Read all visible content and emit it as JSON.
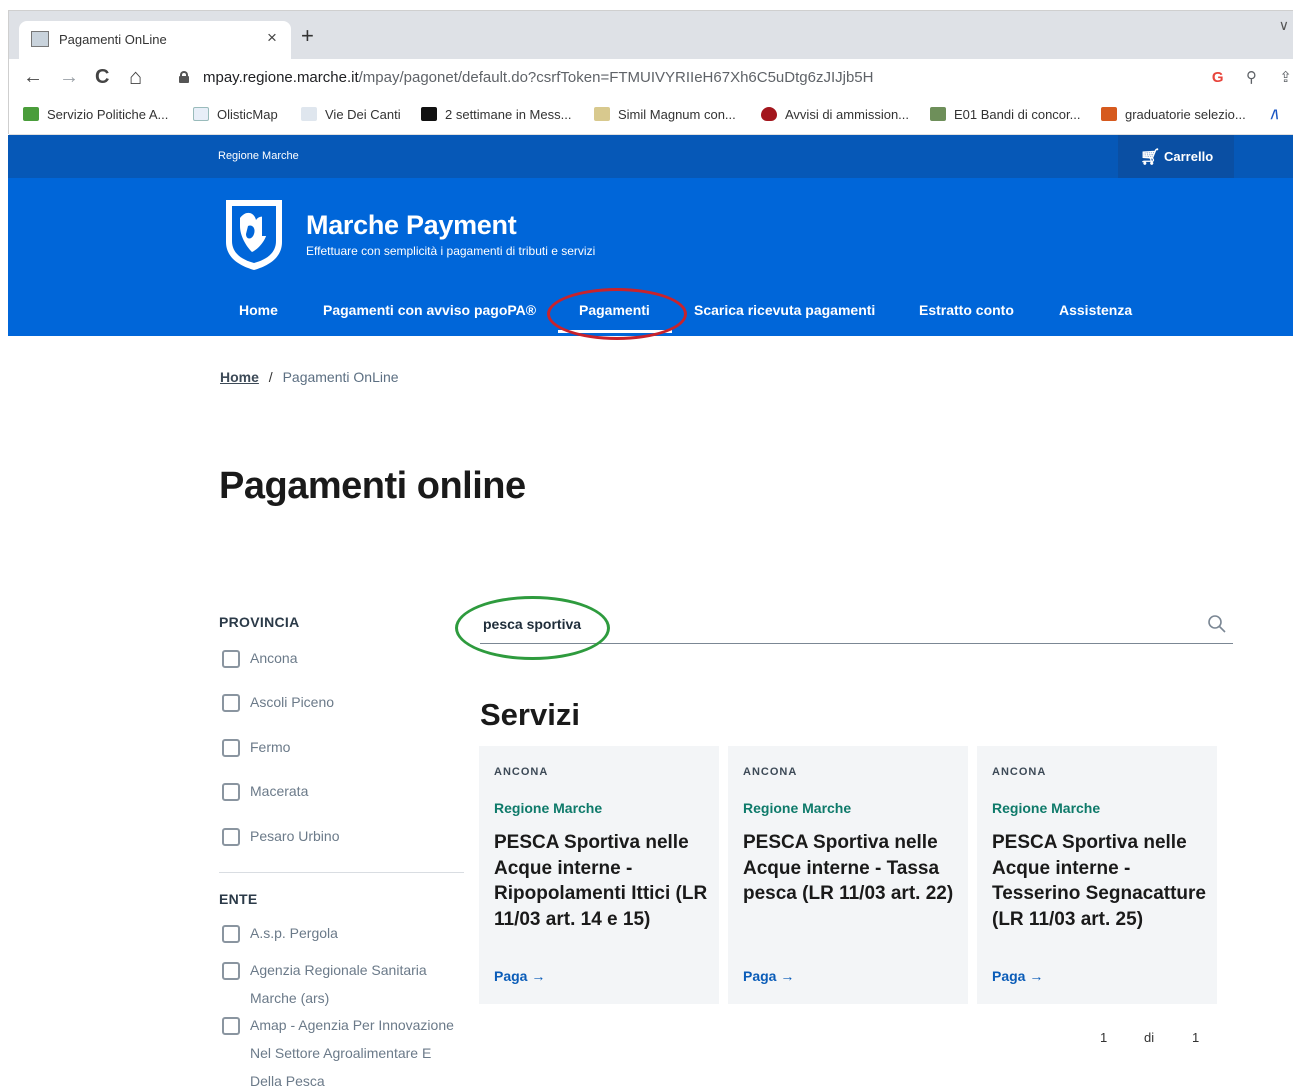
{
  "browser": {
    "tab_title": "Pagamenti OnLine",
    "tab_close": "×",
    "new_tab": "+",
    "tabstrip_menu": "∨",
    "url_host": "mpay.regione.marche.it",
    "url_path": "/mpay/pagonet/default.do?csrfToken=FTMUIVYRIIeH67Xh6C5uDtg6zJIJjb5H",
    "nav": {
      "back": "←",
      "forward": "→",
      "reload": "C",
      "home": "⌂"
    },
    "omnibox_icons": {
      "google": "G",
      "zoom": "⚲",
      "share": "⇪"
    },
    "bookmarks": [
      {
        "label": "Servizio Politiche A...",
        "color": "#4a9d3b"
      },
      {
        "label": "OlisticMap",
        "color": "#e7eef8"
      },
      {
        "label": "Vie Dei Canti",
        "color": "#dfe6ee"
      },
      {
        "label": "2 settimane in Mess...",
        "color": "#111111"
      },
      {
        "label": "Simil Magnum con...",
        "color": "#d8c98e"
      },
      {
        "label": "Avvisi di ammission...",
        "color": "#a3161d"
      },
      {
        "label": "E01 Bandi di concor...",
        "color": "#6e8f5a"
      },
      {
        "label": "graduatorie selezio...",
        "color": "#d65a1e"
      }
    ]
  },
  "site": {
    "region_label": "Regione Marche",
    "cart_label": "Carrello",
    "brand_title": "Marche Payment",
    "brand_subtitle": "Effettuare con semplicità i pagamenti di tributi e servizi",
    "nav": [
      {
        "label": "Home",
        "active": false
      },
      {
        "label": "Pagamenti con avviso pagoPA®",
        "active": false
      },
      {
        "label": "Pagamenti",
        "active": true
      },
      {
        "label": "Scarica ricevuta pagamenti",
        "active": false
      },
      {
        "label": "Estratto conto",
        "active": false
      },
      {
        "label": "Assistenza",
        "active": false
      }
    ]
  },
  "breadcrumb": {
    "home": "Home",
    "separator": "/",
    "current": "Pagamenti OnLine"
  },
  "page_title": "Pagamenti online",
  "filters": {
    "provincia": {
      "heading": "PROVINCIA",
      "options": [
        "Ancona",
        "Ascoli Piceno",
        "Fermo",
        "Macerata",
        "Pesaro Urbino"
      ]
    },
    "ente": {
      "heading": "ENTE",
      "options": [
        "A.s.p. Pergola",
        "Agenzia Regionale Sanitaria Marche (ars)",
        "Amap - Agenzia Per Innovazione Nel Settore Agroalimentare E Della Pesca"
      ]
    }
  },
  "search": {
    "value": "pesca sportiva"
  },
  "section_title": "Servizi",
  "cards": [
    {
      "category": "ANCONA",
      "ente": "Regione Marche",
      "title": "PESCA Sportiva nelle Acque interne - Ripopolamenti Ittici (LR 11/03 art. 14 e 15)",
      "link": "Paga →"
    },
    {
      "category": "ANCONA",
      "ente": "Regione Marche",
      "title": "PESCA Sportiva nelle Acque interne - Tassa pesca (LR 11/03 art. 22)",
      "link": "Paga →"
    },
    {
      "category": "ANCONA",
      "ente": "Regione Marche",
      "title": "PESCA Sportiva nelle Acque interne - Tesserino Segnacatture (LR 11/03 art. 25)",
      "link": "Paga →"
    }
  ],
  "pagination": {
    "current": "1",
    "of": "di",
    "total": "1"
  },
  "colors": {
    "brand_blue": "#0066d9",
    "top_bar": "#0658b7",
    "accent_teal": "#0e7a6a",
    "annotation_red": "#c8232c",
    "annotation_green": "#2e9b3e"
  }
}
